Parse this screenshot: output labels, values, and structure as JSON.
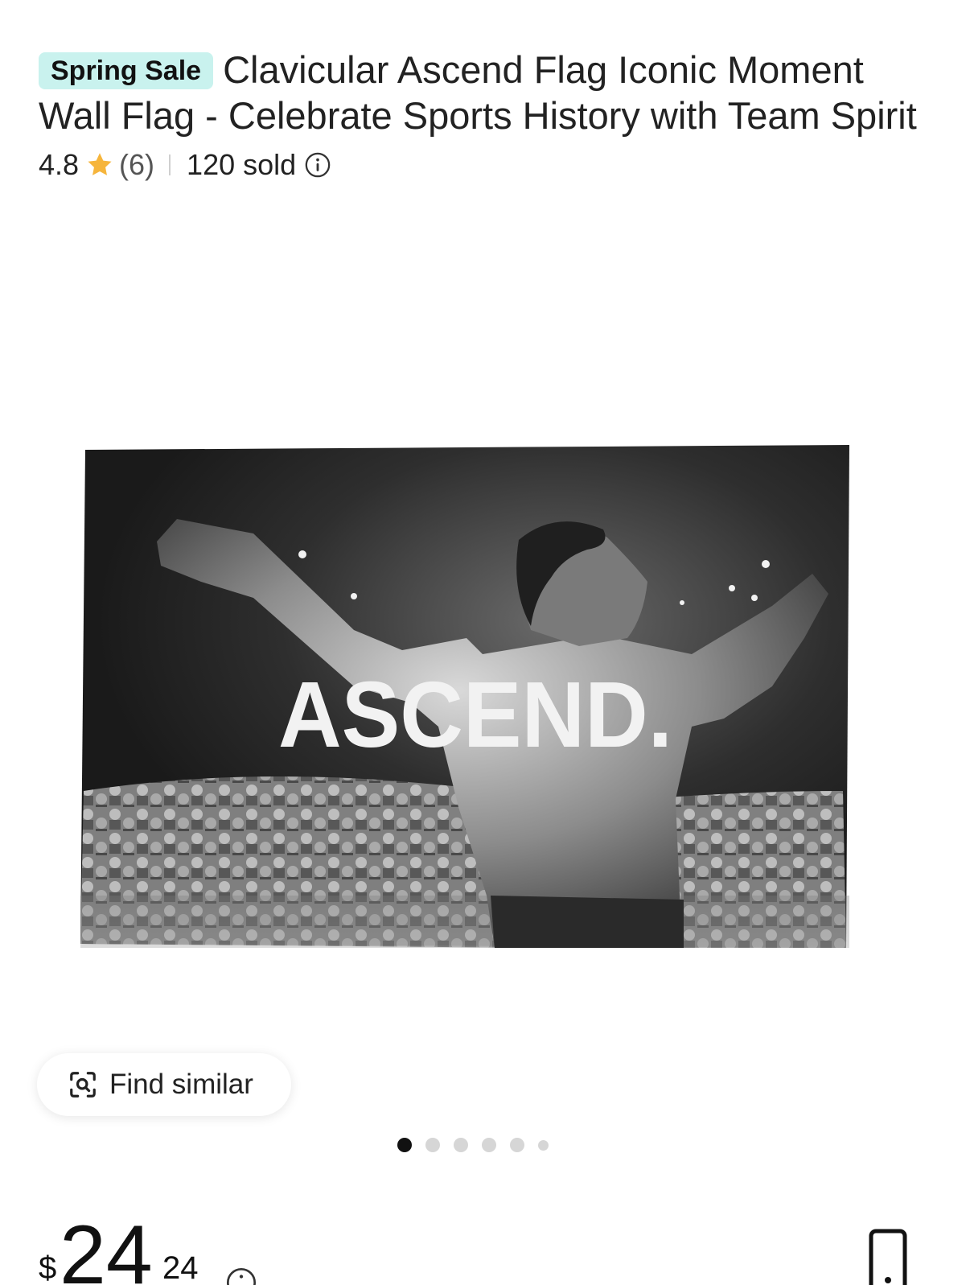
{
  "product": {
    "badge": "Spring Sale",
    "title": "Clavicular Ascend Flag Iconic Moment Wall Flag - Celebrate Sports History with Team Spirit",
    "rating": "4.8",
    "reviews": "(6)",
    "sold": "120 sold",
    "image_text": "ASCEND."
  },
  "actions": {
    "find_similar_label": "Find similar"
  },
  "gallery": {
    "total_images": 6,
    "active_index": 0
  },
  "price": {
    "currency": "$",
    "dollars": "24",
    "cents": "24"
  },
  "colors": {
    "badge_bg": "#c9f2ee",
    "star": "#f6b53c",
    "active_dot": "#111111",
    "inactive_dot": "#d6d6d6"
  },
  "icons": {
    "rating": "star-icon",
    "sold_info": "info-icon",
    "find_similar": "image-search-icon",
    "price_info": "info-icon",
    "device": "device-icon"
  }
}
